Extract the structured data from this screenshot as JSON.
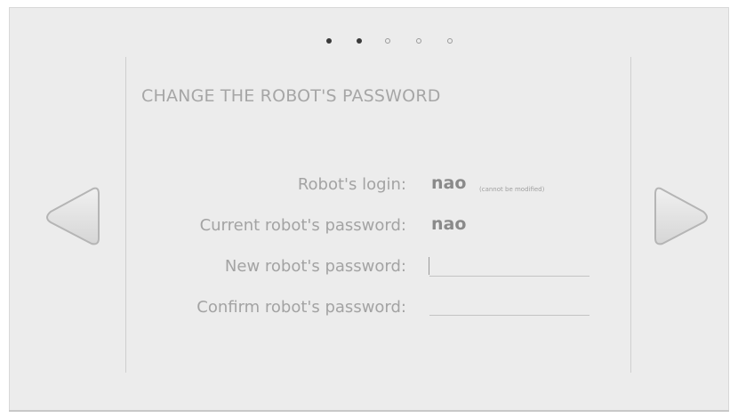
{
  "pager": {
    "total": 5,
    "active_count": 2
  },
  "title": "CHANGE THE ROBOT'S PASSWORD",
  "form": {
    "login_label": "Robot's login:",
    "login_value": "nao",
    "login_note": "(cannot be modified)",
    "current_label": "Current robot's password:",
    "current_value": "nao",
    "new_label": "New robot's password:",
    "new_value": "",
    "confirm_label": "Confirm robot's password:",
    "confirm_value": ""
  },
  "icons": {
    "prev": "triangle-left-icon",
    "next": "triangle-right-icon"
  },
  "colors": {
    "background": "#ececec",
    "text_muted": "#a3a3a3",
    "text_value": "#8a8a8a",
    "arrow_fill": "#e2e2e2",
    "arrow_stroke": "#b9b9b9"
  }
}
